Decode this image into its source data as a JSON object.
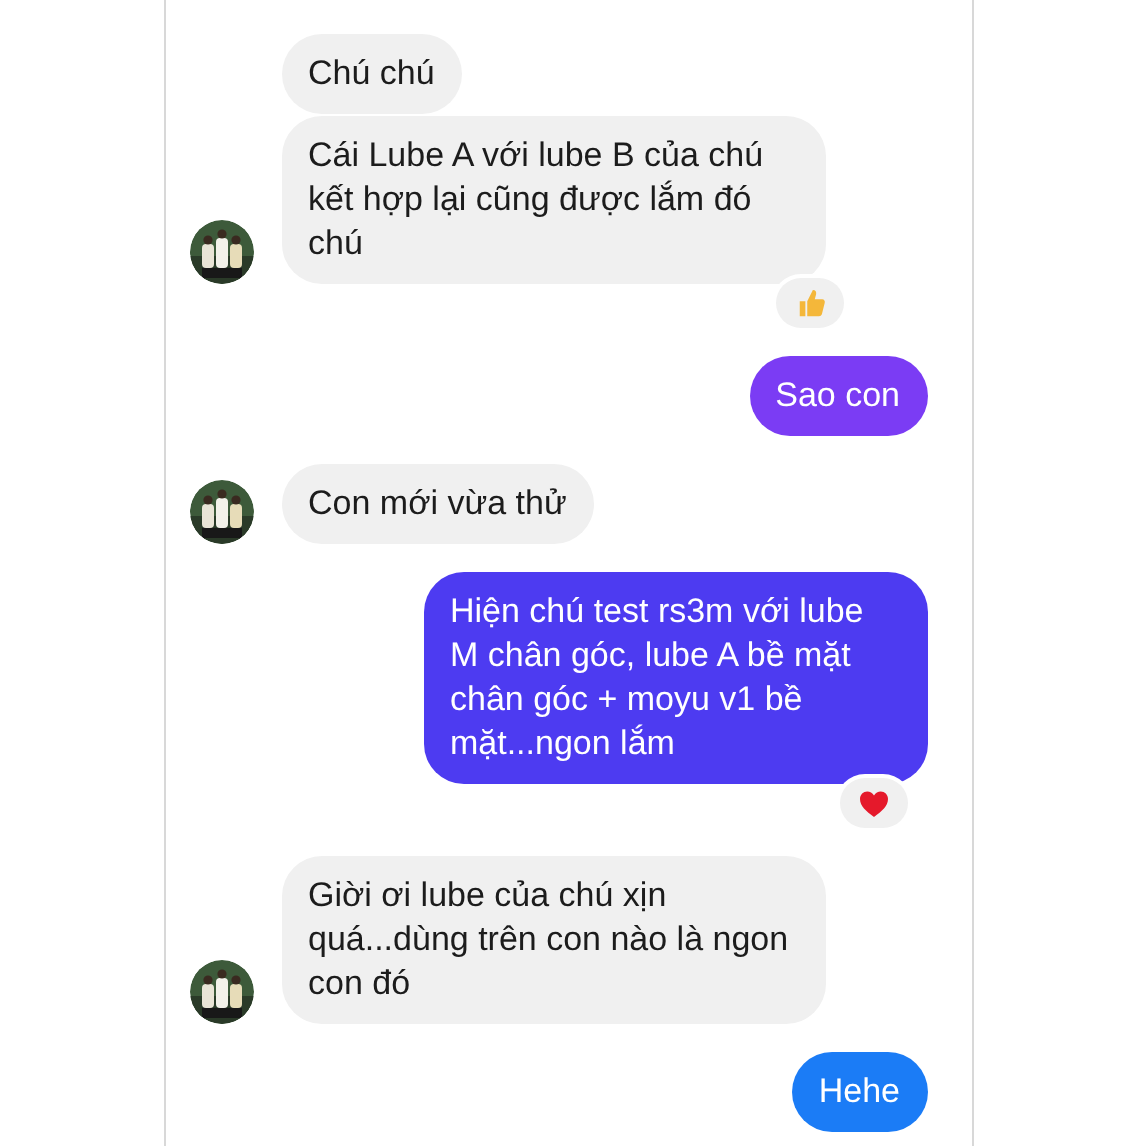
{
  "messages": [
    {
      "kind": "received",
      "text": "Chú chú",
      "avatar": false
    },
    {
      "kind": "received",
      "text": "Cái Lube A với lube B của chú kết hợp lại cũng được lắm đó chú",
      "avatar": true,
      "reaction": {
        "kind": "thumbs_up"
      }
    },
    {
      "kind": "sent",
      "text": "Sao con",
      "color": "#7b3cf4"
    },
    {
      "kind": "received",
      "text": "Con mới vừa thử",
      "avatar": true
    },
    {
      "kind": "sent",
      "text": "Hiện chú test rs3m với lube M chân góc, lube A bề mặt chân góc + moyu v1 bề mặt...ngon lắm",
      "color": "#4d3bf1",
      "reaction": {
        "kind": "heart"
      }
    },
    {
      "kind": "received",
      "text": "Giời ơi lube của chú xịn quá...dùng trên con nào là ngon con đó",
      "avatar": true
    },
    {
      "kind": "sent",
      "text": "Hehe",
      "color": "#1b7cf6"
    }
  ]
}
